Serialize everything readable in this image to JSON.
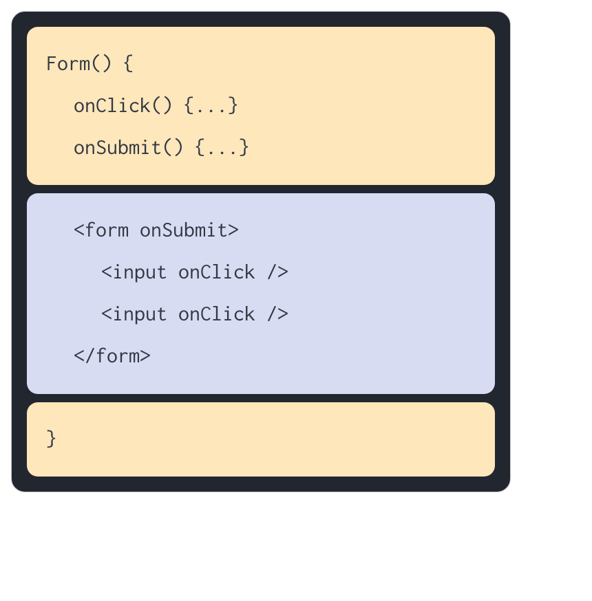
{
  "topBlock": {
    "line1": "Form() {",
    "line2": "onClick() {...}",
    "line3": "onSubmit() {...}"
  },
  "middleBlock": {
    "line1": "<form onSubmit>",
    "line2": "<input onClick />",
    "line3": "<input onClick />",
    "line4": "</form>"
  },
  "bottomBlock": {
    "line1": "}"
  }
}
